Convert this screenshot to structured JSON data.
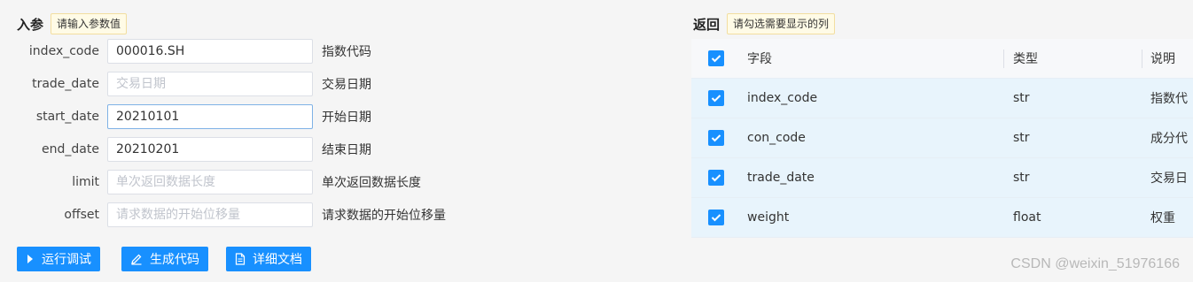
{
  "params": {
    "title": "入参",
    "hint": "请输入参数值",
    "fields": [
      {
        "name": "index_code",
        "value": "000016.SH",
        "placeholder": "",
        "desc": "指数代码"
      },
      {
        "name": "trade_date",
        "value": "",
        "placeholder": "交易日期",
        "desc": "交易日期"
      },
      {
        "name": "start_date",
        "value": "20210101",
        "placeholder": "",
        "desc": "开始日期"
      },
      {
        "name": "end_date",
        "value": "20210201",
        "placeholder": "",
        "desc": "结束日期"
      },
      {
        "name": "limit",
        "value": "",
        "placeholder": "单次返回数据长度",
        "desc": "单次返回数据长度"
      },
      {
        "name": "offset",
        "value": "",
        "placeholder": "请求数据的开始位移量",
        "desc": "请求数据的开始位移量"
      }
    ]
  },
  "buttons": {
    "run": "运行调试",
    "generate": "生成代码",
    "docs": "详细文档"
  },
  "returns": {
    "title": "返回",
    "hint": "请勾选需要显示的列",
    "headers": {
      "field": "字段",
      "type": "类型",
      "desc": "说明"
    },
    "rows": [
      {
        "field": "index_code",
        "type": "str",
        "desc": "指数代",
        "checked": true
      },
      {
        "field": "con_code",
        "type": "str",
        "desc": "成分代",
        "checked": true
      },
      {
        "field": "trade_date",
        "type": "str",
        "desc": "交易日",
        "checked": true
      },
      {
        "field": "weight",
        "type": "float",
        "desc": "权重",
        "checked": true
      }
    ]
  },
  "watermark": "CSDN @weixin_51976166",
  "colors": {
    "primary": "#1890ff",
    "row_highlight": "#e8f4fc",
    "hint_bg": "#fffbe6"
  }
}
